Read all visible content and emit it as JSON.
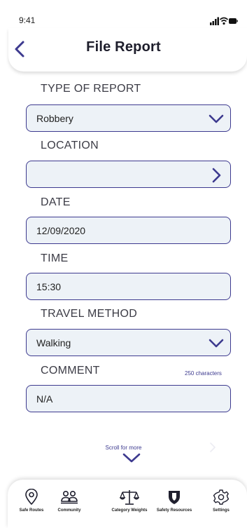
{
  "status_bar": {
    "time": "9:41"
  },
  "header": {
    "title": "File Report"
  },
  "form": {
    "type_label": "TYPE OF REPORT",
    "type_value": "Robbery",
    "location_label": "LOCATION",
    "location_value": "",
    "date_label": "DATE",
    "date_value": "12/09/2020",
    "time_label": "TIME",
    "time_value": "15:30",
    "travel_label": "TRAVEL METHOD",
    "travel_value": "Walking",
    "comment_label": "COMMENT",
    "comment_limit": "250 characters",
    "comment_value": "N/A"
  },
  "scroll_hint": "Scroll for more",
  "tabs": [
    {
      "label": "Safe Routes",
      "icon": "map-pin-icon"
    },
    {
      "label": "Community",
      "icon": "users-icon"
    },
    {
      "label": "Category Weights",
      "icon": "scales-icon"
    },
    {
      "label": "Safety Resources",
      "icon": "shield-icon"
    },
    {
      "label": "Settings",
      "icon": "gear-icon"
    }
  ],
  "colors": {
    "accent": "#3d3a8f",
    "field_bg": "#edf2f7",
    "tab_icon": "#1f1f2e"
  }
}
